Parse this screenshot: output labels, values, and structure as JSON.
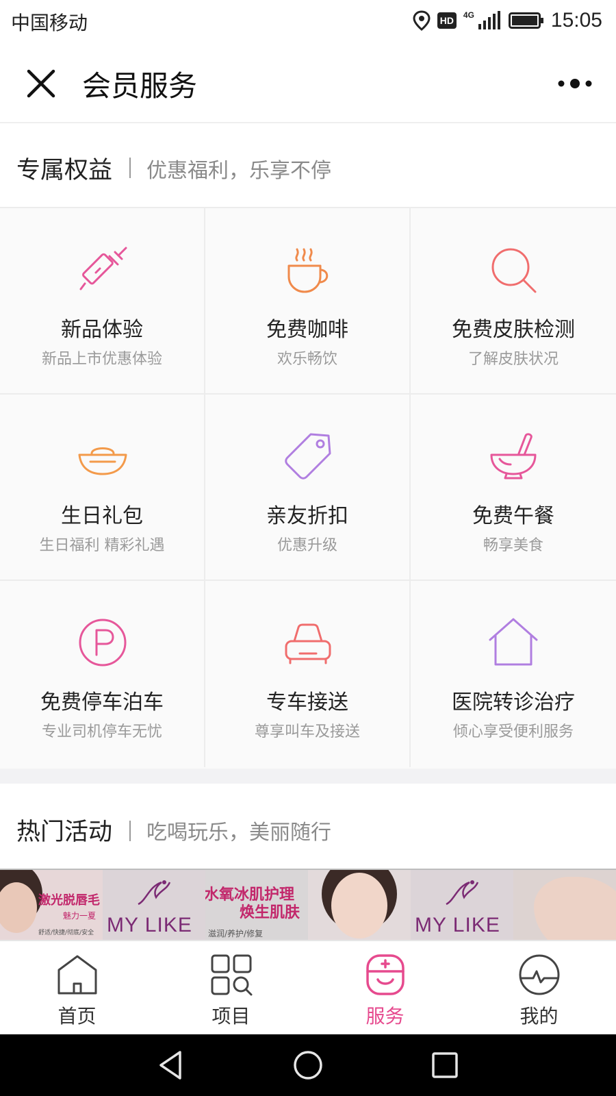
{
  "status_bar": {
    "carrier": "中国移动",
    "network": "4G",
    "hd": "HD",
    "time": "15:05"
  },
  "header": {
    "title": "会员服务",
    "close_icon": "close-icon",
    "more_icon": "more-icon"
  },
  "benefits": {
    "title": "专属权益",
    "subtitle": "优惠福利，乐享不停",
    "items": [
      {
        "title": "新品体验",
        "sub": "新品上市优惠体验",
        "icon": "syringe-icon",
        "color": "#e6579a"
      },
      {
        "title": "免费咖啡",
        "sub": "欢乐畅饮",
        "icon": "coffee-cup-icon",
        "color": "#f08a4b"
      },
      {
        "title": "免费皮肤检测",
        "sub": "了解皮肤状况",
        "icon": "magnifier-icon",
        "color": "#f06d6d"
      },
      {
        "title": "生日礼包",
        "sub": "生日福利 精彩礼遇",
        "icon": "gold-ingot-icon",
        "color": "#f39a4a"
      },
      {
        "title": "亲友折扣",
        "sub": "优惠升级",
        "icon": "price-tag-icon",
        "color": "#b07ee0"
      },
      {
        "title": "免费午餐",
        "sub": "畅享美食",
        "icon": "mortar-bowl-icon",
        "color": "#e6579a"
      },
      {
        "title": "免费停车泊车",
        "sub": "专业司机停车无忧",
        "icon": "parking-icon",
        "color": "#e6579a"
      },
      {
        "title": "专车接送",
        "sub": "尊享叫车及接送",
        "icon": "car-icon",
        "color": "#f06d6d"
      },
      {
        "title": "医院转诊治疗",
        "sub": "倾心享受便利服务",
        "icon": "house-icon",
        "color": "#b07ee0"
      }
    ]
  },
  "activities": {
    "title": "热门活动",
    "subtitle": "吃喝玩乐，美丽随行",
    "banner": {
      "brand": "MY LIKE",
      "promo_laser": "激光脱唇毛",
      "promo_laser_tag": "魅力一夏",
      "promo_laser_note": "舒适/快捷/彻底/安全",
      "promo_hydro_1": "水氧冰肌护理",
      "promo_hydro_2": "焕生肌肤",
      "promo_hydro_note": "滋润/养护/修复"
    }
  },
  "tab_bar": {
    "tabs": [
      {
        "label": "首页",
        "icon": "home-icon",
        "active": false
      },
      {
        "label": "项目",
        "icon": "grid-search-icon",
        "active": false
      },
      {
        "label": "服务",
        "icon": "service-icon",
        "active": true
      },
      {
        "label": "我的",
        "icon": "profile-icon",
        "active": false
      }
    ],
    "active_color": "#e64a8e"
  },
  "system_nav": {
    "back_icon": "back-icon",
    "home_icon": "home-circle-icon",
    "recents_icon": "recents-icon"
  }
}
